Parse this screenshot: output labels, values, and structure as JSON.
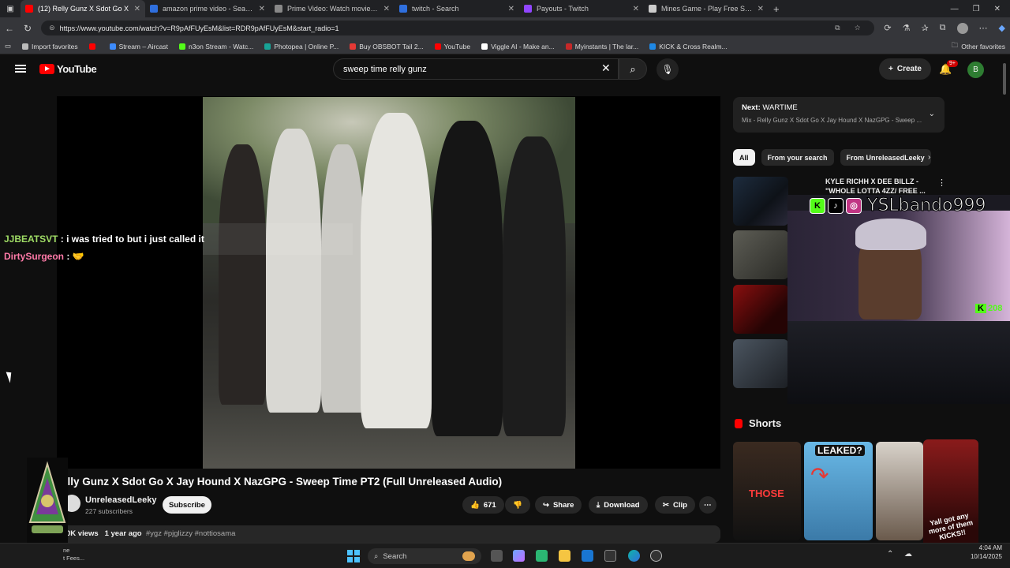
{
  "tabs": [
    {
      "label": "(12) Relly Gunz X Sdot Go X",
      "color": "#ff0000",
      "active": true
    },
    {
      "label": "amazon prime video - Search",
      "color": "#2f6fde"
    },
    {
      "label": "Prime Video: Watch movies, TV sh",
      "color": "#888888"
    },
    {
      "label": "twitch - Search",
      "color": "#2f6fde"
    },
    {
      "label": "Payouts - Twitch",
      "color": "#9146ff"
    },
    {
      "label": "Mines Game - Play Free Social Ca",
      "color": "#cccccc"
    }
  ],
  "address": {
    "url": "https://www.youtube.com/watch?v=R9pAfFUyEsM&list=RDR9pAfFUyEsM&start_radio=1"
  },
  "bookmarks": [
    {
      "label": "Import favorites",
      "color": "#bbbbbb"
    },
    {
      "label": "",
      "color": "#ff0000"
    },
    {
      "label": "Stream – Aircast",
      "color": "#3d8bfd"
    },
    {
      "label": "n3on Stream - Watc...",
      "color": "#53fc18"
    },
    {
      "label": "Photopea | Online P...",
      "color": "#18a497"
    },
    {
      "label": "Buy OBSBOT Tail 2...",
      "color": "#e53935"
    },
    {
      "label": "YouTube",
      "color": "#ff0000"
    },
    {
      "label": "Viggle AI - Make an...",
      "color": "#ffffff"
    },
    {
      "label": "Myinstants | The lar...",
      "color": "#c62828"
    },
    {
      "label": "KICK & Cross Realm...",
      "color": "#1e88e5"
    }
  ],
  "bookmarks_other": "Other favorites",
  "youtube": {
    "logo": "YouTube",
    "search_value": "sweep time relly gunz",
    "create_label": "Create",
    "notif_badge": "9+",
    "avatar_letter": "B"
  },
  "chat": [
    {
      "user": "JJBEATSVT",
      "message": " : i was tried to but i just called it"
    },
    {
      "user": "DirtySurgeon",
      "message": " : 🤝"
    }
  ],
  "video": {
    "title": "elly Gunz X Sdot Go X Jay Hound X NazGPG - Sweep Time PT2 (Full Unreleased Audio)",
    "channel": "UnreleasedLeeky",
    "subscribers": "227 subscribers",
    "subscribe_label": "Subscribe",
    "likes": "671",
    "share_label": "Share",
    "download_label": "Download",
    "clip_label": "Clip",
    "views": "0K views",
    "age": "1 year ago",
    "tags": "#ygz #pjglizzy #nottiosama"
  },
  "next": {
    "label": "Next:",
    "title": "WARTIME",
    "subtitle": "Mix - Relly Gunz X Sdot Go X Jay Hound X NazGPG - Sweep ..."
  },
  "chips": [
    "All",
    "From your search",
    "From UnreleasedLeeky"
  ],
  "recs": [
    {
      "title": "KYLE RICHH X DEE BILLZ - \"WHOLE LOTTA 4ZZ/ FREE ..."
    }
  ],
  "webcam": {
    "name": "YSLbando999",
    "badge": "K",
    "badge_text": "208"
  },
  "shorts": {
    "heading": "Shorts",
    "items": [
      {
        "text": "THOSE"
      },
      {
        "text": "LEAKED?"
      },
      {
        "text": ""
      },
      {
        "text": "Yall got any more of them KICKS!!"
      }
    ]
  },
  "taskbar": {
    "search_label": "Search",
    "time": "4:04 AM",
    "date": "10/14/2025",
    "left_line1": "ne",
    "left_line2": "t Fees..."
  }
}
